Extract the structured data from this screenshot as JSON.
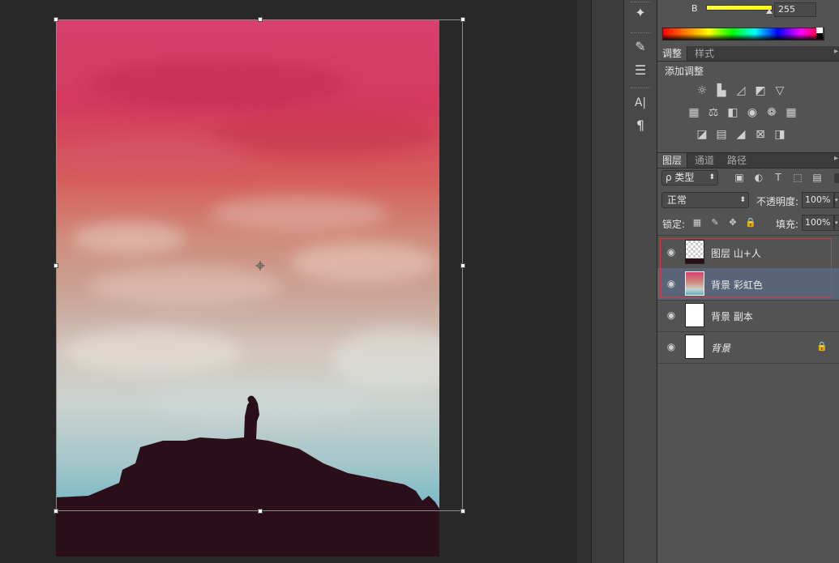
{
  "color_panel": {
    "channel_label": "B",
    "channel_value": "255",
    "slider_value_fraction": 1.0
  },
  "tools": {
    "items": [
      {
        "name": "color-sampler-icon",
        "glyph": "✦"
      },
      {
        "name": "brush-presets-icon",
        "glyph": "✎"
      },
      {
        "name": "adjust-sliders-icon",
        "glyph": "☰"
      },
      {
        "name": "character-icon",
        "glyph": "A|"
      },
      {
        "name": "paragraph-icon",
        "glyph": "¶"
      }
    ]
  },
  "adjustments": {
    "tabs": [
      {
        "label": "调整",
        "active": true
      },
      {
        "label": "样式",
        "active": false
      }
    ],
    "add_label": "添加调整",
    "rows": [
      [
        {
          "name": "brightness-icon",
          "glyph": "☼"
        },
        {
          "name": "levels-icon",
          "glyph": "▙"
        },
        {
          "name": "curves-icon",
          "glyph": "◿"
        },
        {
          "name": "exposure-icon",
          "glyph": "◩"
        },
        {
          "name": "vibrance-icon",
          "glyph": "▽"
        }
      ],
      [
        {
          "name": "hue-saturation-icon",
          "glyph": "▦"
        },
        {
          "name": "color-balance-icon",
          "glyph": "⚖"
        },
        {
          "name": "black-white-icon",
          "glyph": "◧"
        },
        {
          "name": "photo-filter-icon",
          "glyph": "◉"
        },
        {
          "name": "channel-mixer-icon",
          "glyph": "❁"
        },
        {
          "name": "color-lookup-icon",
          "glyph": "▦"
        }
      ],
      [
        {
          "name": "invert-icon",
          "glyph": "◪"
        },
        {
          "name": "posterize-icon",
          "glyph": "▤"
        },
        {
          "name": "threshold-icon",
          "glyph": "◢"
        },
        {
          "name": "selective-color-icon",
          "glyph": "⊠"
        },
        {
          "name": "gradient-map-icon",
          "glyph": "◨"
        }
      ]
    ]
  },
  "layers_panel": {
    "tabs": [
      {
        "label": "图层",
        "active": true
      },
      {
        "label": "通道",
        "active": false
      },
      {
        "label": "路径",
        "active": false
      }
    ],
    "filter_label": "ρ 类型",
    "filter_icons": [
      {
        "name": "filter-pixel-icon",
        "glyph": "▣"
      },
      {
        "name": "filter-adjust-icon",
        "glyph": "◐"
      },
      {
        "name": "filter-type-icon",
        "glyph": "T"
      },
      {
        "name": "filter-shape-icon",
        "glyph": "⬚"
      },
      {
        "name": "filter-smart-icon",
        "glyph": "▤"
      }
    ],
    "blend_mode": "正常",
    "opacity_label": "不透明度:",
    "opacity_value": "100%",
    "lock_label": "锁定:",
    "lock_icons": [
      {
        "name": "lock-transparent-icon",
        "glyph": "▦"
      },
      {
        "name": "lock-paint-icon",
        "glyph": "✎"
      },
      {
        "name": "lock-move-icon",
        "glyph": "✥"
      },
      {
        "name": "lock-all-icon",
        "glyph": "🔒"
      }
    ],
    "fill_label": "填充:",
    "fill_value": "100%",
    "layers": [
      {
        "name": "图层 山+人",
        "thumb": "transparent",
        "selected": false,
        "highlight": true,
        "locked": false
      },
      {
        "name": "背景 彩虹色",
        "thumb": "gradient",
        "selected": true,
        "highlight": true,
        "locked": false
      },
      {
        "name": "背景 副本",
        "thumb": "white",
        "selected": false,
        "highlight": false,
        "locked": false
      },
      {
        "name": "背景",
        "thumb": "white",
        "selected": false,
        "highlight": false,
        "locked": true
      }
    ]
  },
  "colors": {
    "accent_highlight": "#d9363e",
    "selected_row": "#5a6478",
    "panel_bg": "#535353"
  }
}
